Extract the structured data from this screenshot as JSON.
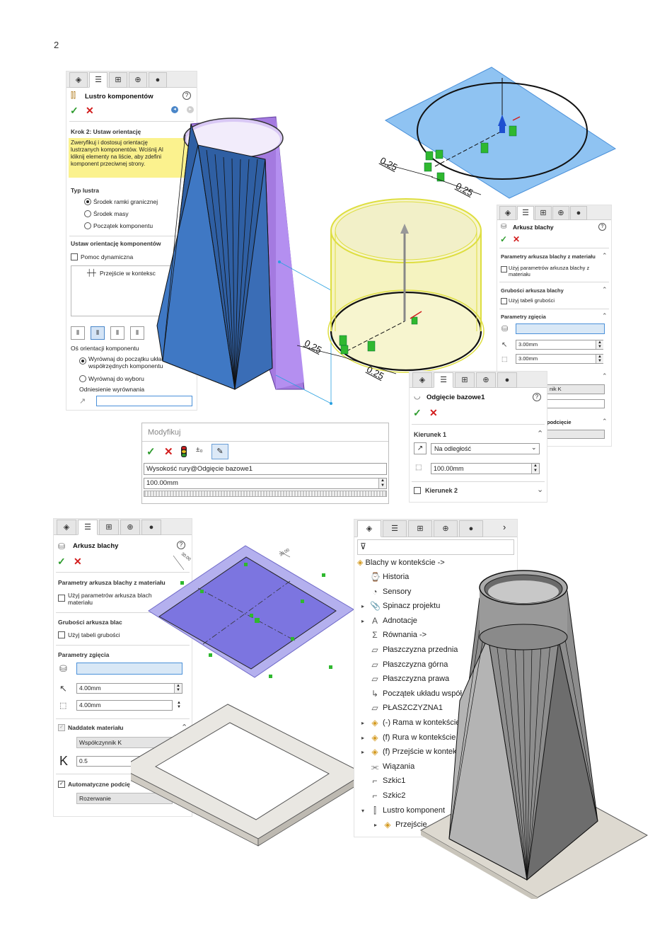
{
  "page_number": "2",
  "mirror_panel": {
    "title": "Lustro komponentów",
    "step": "Krok 2: Ustaw orientację",
    "info": "Zweryfikuj i dostosuj orientację lustrzanych komponentów. Wciśnij Alt i kliknij elementy na liście, aby zdefiniować komponent przeciwnej strony.",
    "info_lines": [
      "Zweryfikuj i dostosuj orientację",
      "lustrzanych komponentów. Wciśnij Al",
      "kliknij elementy na liście, aby zdefini",
      "komponent przeciwnej strony."
    ],
    "mirror_type_label": "Typ lustra",
    "mirror_types": [
      "Środek ramki granicznej",
      "Środek masy",
      "Początek komponentu"
    ],
    "orient_label": "Ustaw orientację komponentów",
    "dynamic_help": "Pomoc dynamiczna",
    "list_item": "Przejście w konteksc",
    "axis_label": "Oś orientacji komponentu",
    "axis_opt1_a": "Wyrównaj do początku układu",
    "axis_opt1_b": "współrzędnych komponentu",
    "axis_opt2": "Wyrównaj do wyboru",
    "align_ref": "Odniesienie wyrównania"
  },
  "sheet_panel_small": {
    "title": "Arkusz blachy",
    "params_material": "Parametry arkusza blachy z materiału",
    "use_params_a": "Użyj parametrów arkusza blachy z",
    "use_params_b": "materiału",
    "thickness_label": "Grubości arkusza blachy",
    "use_thickness_table": "Użyj tabeli grubości",
    "bend_params": "Parametry zgięcia",
    "radius": "3.00mm",
    "thickness": "3.00mm",
    "k_partial": "nik K",
    "relief_partial": "podcięcie"
  },
  "cut_panel": {
    "title": "Odgięcie bazowe1",
    "dir1": "Kierunek 1",
    "end_condition": "Na odległość",
    "distance": "100.00mm",
    "dir2": "Kierunek 2"
  },
  "modify_dialog": {
    "title": "Modyfikuj",
    "dimension_name": "Wysokość rury@Odgięcie bazowe1",
    "value": "100.00mm"
  },
  "top_dims": {
    "d1": "0.25",
    "d2": "0.25",
    "d3": "0.25",
    "d4": "0.25"
  },
  "plate_dims": {
    "a": "30.00",
    "b": "30.00"
  },
  "sheet_panel_large": {
    "title": "Arkusz blachy",
    "params_material": "Parametry arkusza blachy z materiału",
    "use_params_a": "Użyj parametrów arkusza blach",
    "use_params_b": "materiału",
    "thickness_label": "Grubości arkusza blac",
    "use_thickness_table": "Użyj tabeli grubości",
    "bend_params": "Parametry zgięcia",
    "radius": "4.00mm",
    "thickness": "4.00mm",
    "allowance": "Naddatek materiału",
    "k_factor_label": "Współczynnik K",
    "k": "K",
    "k_value": "0.5",
    "auto_relief": "Automatyczne podcię",
    "relief_type": "Rozerwanie"
  },
  "feature_tree": {
    "root": "Blachy w kontekście ->",
    "items": [
      {
        "label": "Historia",
        "icon": "history-icon"
      },
      {
        "label": "Sensory",
        "icon": "sensor-icon"
      },
      {
        "label": "Spinacz projektu",
        "icon": "paperclip-icon"
      },
      {
        "label": "Adnotacje",
        "icon": "annotation-icon"
      },
      {
        "label": "Równania ->",
        "icon": "equation-icon"
      },
      {
        "label": "Płaszczyzna przednia",
        "icon": "plane-icon"
      },
      {
        "label": "Płaszczyzna górna",
        "icon": "plane-icon"
      },
      {
        "label": "Płaszczyzna prawa",
        "icon": "plane-icon"
      },
      {
        "label": "Początek układu współ",
        "icon": "origin-icon"
      },
      {
        "label": "PŁASZCZYZNA1",
        "icon": "plane-icon"
      },
      {
        "label": "(-) Rama w kontekście",
        "icon": "part-icon"
      },
      {
        "label": "(f) Rura w kontekście",
        "icon": "part-icon"
      },
      {
        "label": "(f) Przejście w kontek",
        "icon": "part-icon"
      },
      {
        "label": "Wiązania",
        "icon": "mates-icon"
      },
      {
        "label": "Szkic1",
        "icon": "sketch-icon"
      },
      {
        "label": "Szkic2",
        "icon": "sketch-icon"
      },
      {
        "label": "Lustro komponent",
        "icon": "mirror-icon"
      },
      {
        "label": "Przejście",
        "icon": "part-icon"
      }
    ]
  },
  "colors": {
    "ok": "#2e9c2e",
    "cancel": "#d21d1d",
    "blue_body": "#3a6fb0",
    "purple": "#9b6fd8",
    "yellow": "#f4f2b8",
    "plane": "#7fb8f0"
  }
}
